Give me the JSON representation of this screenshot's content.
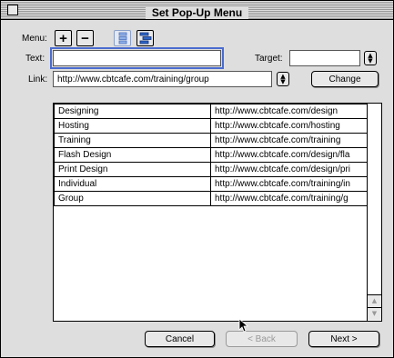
{
  "window": {
    "title": "Set Pop-Up Menu"
  },
  "menu": {
    "label": "Menu:",
    "add_glyph": "+",
    "remove_glyph": "−"
  },
  "text_field": {
    "label": "Text:",
    "value": ""
  },
  "target_field": {
    "label": "Target:",
    "value": ""
  },
  "link_field": {
    "label": "Link:",
    "value": "http://www.cbtcafe.com/training/group"
  },
  "buttons": {
    "change": "Change",
    "cancel": "Cancel",
    "back": "< Back",
    "next": "Next >"
  },
  "items": [
    {
      "text": "Designing",
      "link": "http://www.cbtcafe.com/design"
    },
    {
      "text": "Hosting",
      "link": "http://www.cbtcafe.com/hosting"
    },
    {
      "text": "Training",
      "link": "http://www.cbtcafe.com/training"
    },
    {
      "text": "Flash Design",
      "link": "http://www.cbtcafe.com/design/fla"
    },
    {
      "text": "Print Design",
      "link": "http://www.cbtcafe.com/design/pri"
    },
    {
      "text": "Individual",
      "link": "http://www.cbtcafe.com/training/in"
    },
    {
      "text": "Group",
      "link": "http://www.cbtcafe.com/training/g"
    }
  ],
  "icons": [
    "close-box-icon",
    "add-item-icon",
    "remove-item-icon",
    "outdent-icon",
    "indent-icon",
    "target-dropdown-icon",
    "link-dropdown-icon",
    "scroll-up-icon",
    "scroll-down-icon",
    "mouse-pointer-icon"
  ],
  "colors": {
    "window_bg": "#dedede",
    "focus_ring": "#4a6ccf",
    "icon_blue": "#2f66c8"
  }
}
